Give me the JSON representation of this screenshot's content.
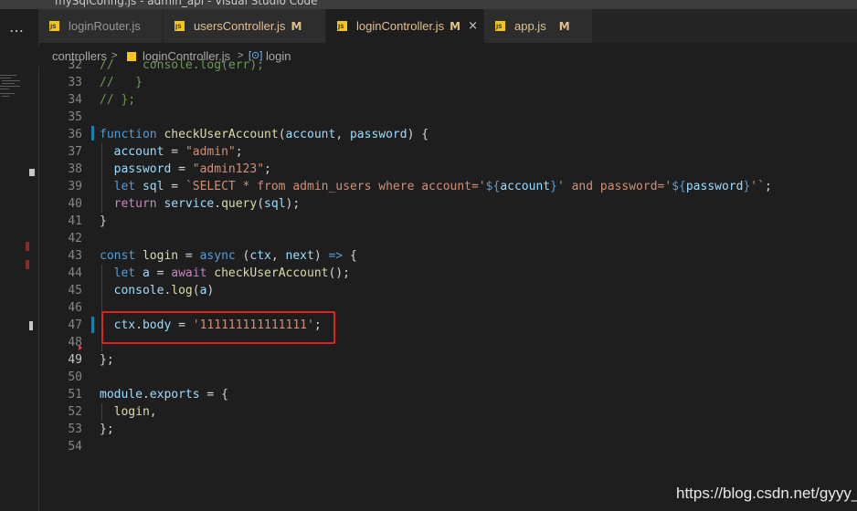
{
  "window": {
    "title": "mySqlConfig.js - admin_api - Visual Studio Code"
  },
  "activity": {
    "more_icon": "…"
  },
  "tabs": [
    {
      "label": "loginRouter.js",
      "modified": "",
      "active": false,
      "color": "#969696"
    },
    {
      "label": "usersController.js",
      "modified": "M",
      "active": false,
      "color": "#e2c08d"
    },
    {
      "label": "loginController.js",
      "modified": "M",
      "active": true,
      "color": "#e2c08d",
      "close": "×"
    },
    {
      "label": "app.js",
      "modified": "M",
      "active": false,
      "color": "#e2c08d"
    }
  ],
  "breadcrumb": {
    "folder": "controllers",
    "file": "loginController.js",
    "symbol": "login",
    "sep": ">"
  },
  "editor": {
    "current_line": "49",
    "lines": [
      {
        "num": "32",
        "text": "//    console.log(err);"
      },
      {
        "num": "33",
        "text": "//   }"
      },
      {
        "num": "34",
        "text": "// };"
      },
      {
        "num": "35",
        "text": ""
      },
      {
        "num": "36",
        "text": "function checkUserAccount(account, password) {"
      },
      {
        "num": "37",
        "text": "  account = \"admin\";"
      },
      {
        "num": "38",
        "text": "  password = \"admin123\";"
      },
      {
        "num": "39",
        "text": "  let sql = `SELECT * from admin_users where account='${account}' and password='${password}'`;"
      },
      {
        "num": "40",
        "text": "  return service.query(sql);"
      },
      {
        "num": "41",
        "text": "}"
      },
      {
        "num": "42",
        "text": ""
      },
      {
        "num": "43",
        "text": "const login = async (ctx, next) => {"
      },
      {
        "num": "44",
        "text": "  let a = await checkUserAccount();"
      },
      {
        "num": "45",
        "text": "  console.log(a)"
      },
      {
        "num": "46",
        "text": ""
      },
      {
        "num": "47",
        "text": "  ctx.body = '111111111111111';"
      },
      {
        "num": "48",
        "text": ""
      },
      {
        "num": "49",
        "text": "};"
      },
      {
        "num": "50",
        "text": ""
      },
      {
        "num": "51",
        "text": "module.exports = {"
      },
      {
        "num": "52",
        "text": "  login,"
      },
      {
        "num": "53",
        "text": "};"
      },
      {
        "num": "54",
        "text": ""
      }
    ]
  },
  "watermark": "https://blog.csdn.net/gyyy_",
  "colors": {
    "highlight_box": "#e02020",
    "js_icon": "#f5c51a",
    "modified": "#e2c08d"
  }
}
